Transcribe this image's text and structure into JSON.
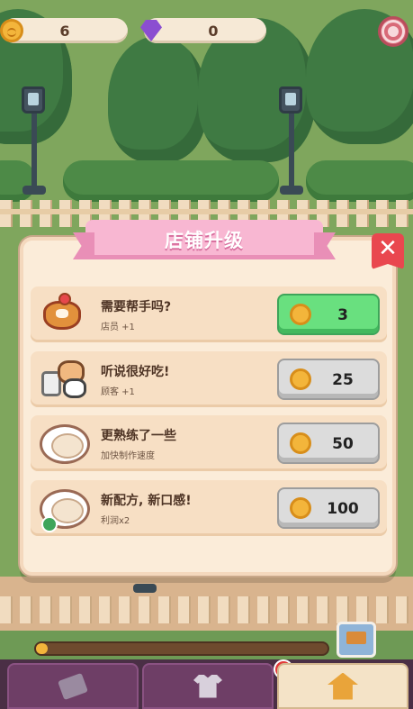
{
  "hud": {
    "coins": "6",
    "gems": "0",
    "coin_icon": "coin-icon",
    "gem_icon": "gem-icon",
    "settings_icon": "gear-icon"
  },
  "dialog": {
    "title": "店铺升级",
    "close_icon": "close-icon",
    "items": [
      {
        "title": "需要帮手吗?",
        "subtitle": "店员 +1",
        "price": "3",
        "icon": "dog-staff-icon",
        "affordable": true
      },
      {
        "title": "听说很好吃!",
        "subtitle": "顾客 +1",
        "price": "25",
        "icon": "customers-icon",
        "affordable": false
      },
      {
        "title": "更熟练了一些",
        "subtitle": "加快制作速度",
        "price": "50",
        "icon": "bun-plate-icon",
        "affordable": false
      },
      {
        "title": "新配方, 新口感!",
        "subtitle": "利润x2",
        "price": "100",
        "icon": "bun-plate-upgrade-icon",
        "affordable": false
      }
    ]
  },
  "bottom": {
    "progress": 0.02,
    "truck_icon": "delivery-truck-icon",
    "tabs": [
      {
        "icon": "recipe-paper-icon",
        "active": false
      },
      {
        "icon": "shirt-icon",
        "active": false,
        "alert": "!"
      },
      {
        "icon": "shop-upgrade-icon",
        "active": true
      }
    ]
  },
  "colors": {
    "accent_pink": "#f8b7d2",
    "buy_green": "#69e07f",
    "close_red": "#e9474f",
    "panel": "#fbecd9"
  }
}
